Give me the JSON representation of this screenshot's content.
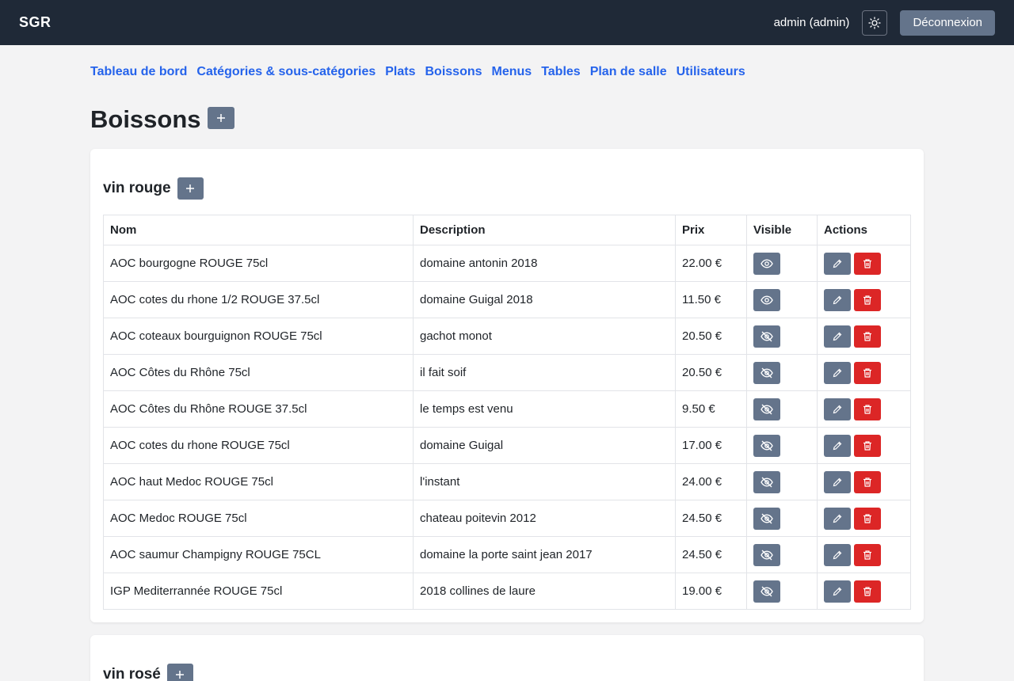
{
  "header": {
    "brand": "SGR",
    "user": "admin (admin)",
    "logout_label": "Déconnexion"
  },
  "nav": [
    "Tableau de bord",
    "Catégories & sous-catégories",
    "Plats",
    "Boissons",
    "Menus",
    "Tables",
    "Plan de salle",
    "Utilisateurs"
  ],
  "page": {
    "title": "Boissons",
    "add_symbol": "+"
  },
  "sections": [
    {
      "title": "vin rouge",
      "columns": [
        "Nom",
        "Description",
        "Prix",
        "Visible",
        "Actions"
      ],
      "rows": [
        {
          "nom": "AOC bourgogne ROUGE 75cl",
          "description": "domaine antonin 2018",
          "prix": "22.00 €",
          "visible": true
        },
        {
          "nom": "AOC cotes du rhone 1/2 ROUGE 37.5cl",
          "description": "domaine Guigal 2018",
          "prix": "11.50 €",
          "visible": true
        },
        {
          "nom": "AOC coteaux bourguignon ROUGE 75cl",
          "description": "gachot monot",
          "prix": "20.50 €",
          "visible": false
        },
        {
          "nom": "AOC Côtes du Rhône 75cl",
          "description": "il fait soif",
          "prix": "20.50 €",
          "visible": false
        },
        {
          "nom": "AOC Côtes du Rhône ROUGE 37.5cl",
          "description": "le temps est venu",
          "prix": "9.50 €",
          "visible": false
        },
        {
          "nom": "AOC cotes du rhone ROUGE 75cl",
          "description": "domaine Guigal",
          "prix": "17.00 €",
          "visible": false
        },
        {
          "nom": "AOC haut Medoc ROUGE 75cl",
          "description": "l'instant",
          "prix": "24.00 €",
          "visible": false
        },
        {
          "nom": "AOC Medoc ROUGE 75cl",
          "description": "chateau poitevin 2012",
          "prix": "24.50 €",
          "visible": false
        },
        {
          "nom": "AOC saumur Champigny ROUGE 75CL",
          "description": "domaine la porte saint jean 2017",
          "prix": "24.50 €",
          "visible": false
        },
        {
          "nom": "IGP Mediterrannée ROUGE 75cl",
          "description": "2018 collines de laure",
          "prix": "19.00 €",
          "visible": false
        }
      ]
    },
    {
      "title": "vin rosé"
    }
  ],
  "colors": {
    "topbar": "#1f2937",
    "link": "#2563eb",
    "button_gray": "#64748b",
    "button_red": "#dc2626"
  },
  "icons": {
    "theme": "sun-icon",
    "add": "plus-icon",
    "visible": "eye-icon",
    "hidden": "eye-off-icon",
    "edit": "pencil-icon",
    "delete": "trash-icon"
  }
}
